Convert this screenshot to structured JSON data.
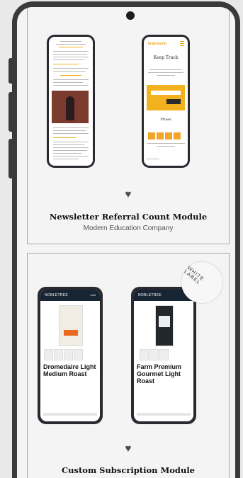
{
  "cards": [
    {
      "title": "Newsletter Referral Count Module",
      "subtitle": "Modern Education Company",
      "mock_right": {
        "logo": "brainstorm",
        "heading": "Keep Track",
        "prizes_heading": "Prizes"
      }
    },
    {
      "title": "Custom Subscription Module",
      "badge": "WHITE LABEL",
      "brand": "NOBLETREE",
      "products": [
        "Dromedaire Light Medium Roast",
        "Farm Premium Gourmet Light Roast"
      ],
      "cart_label": "Cart"
    }
  ],
  "icons": {
    "favorite": "heart-icon"
  },
  "colors": {
    "accent_yellow": "#f2b21f",
    "brand_navy": "#172433",
    "device": "#3a3a3c"
  }
}
